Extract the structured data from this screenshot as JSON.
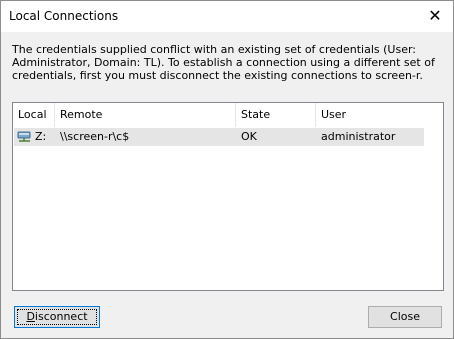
{
  "window": {
    "title": "Local Connections",
    "close_symbol": "✕"
  },
  "message": "The credentials supplied conflict with an existing set of credentials (User: Administrator, Domain: TL). To establish a connection using a different set of credentials, first you must disconnect the existing connections to screen-r.",
  "list": {
    "columns": [
      "Local",
      "Remote",
      "State",
      "User"
    ],
    "rows": [
      {
        "icon": "network-drive-icon",
        "local": "Z:",
        "remote": "\\\\screen-r\\c$",
        "state": "OK",
        "user": "administrator",
        "selected": true
      }
    ]
  },
  "buttons": {
    "disconnect": {
      "label_first": "D",
      "label_rest": "isconnect"
    },
    "close": "Close"
  },
  "colors": {
    "selection": "#e5e5e5",
    "default_button_border": "#0078d7",
    "window_bg": "#f0f0f0"
  }
}
